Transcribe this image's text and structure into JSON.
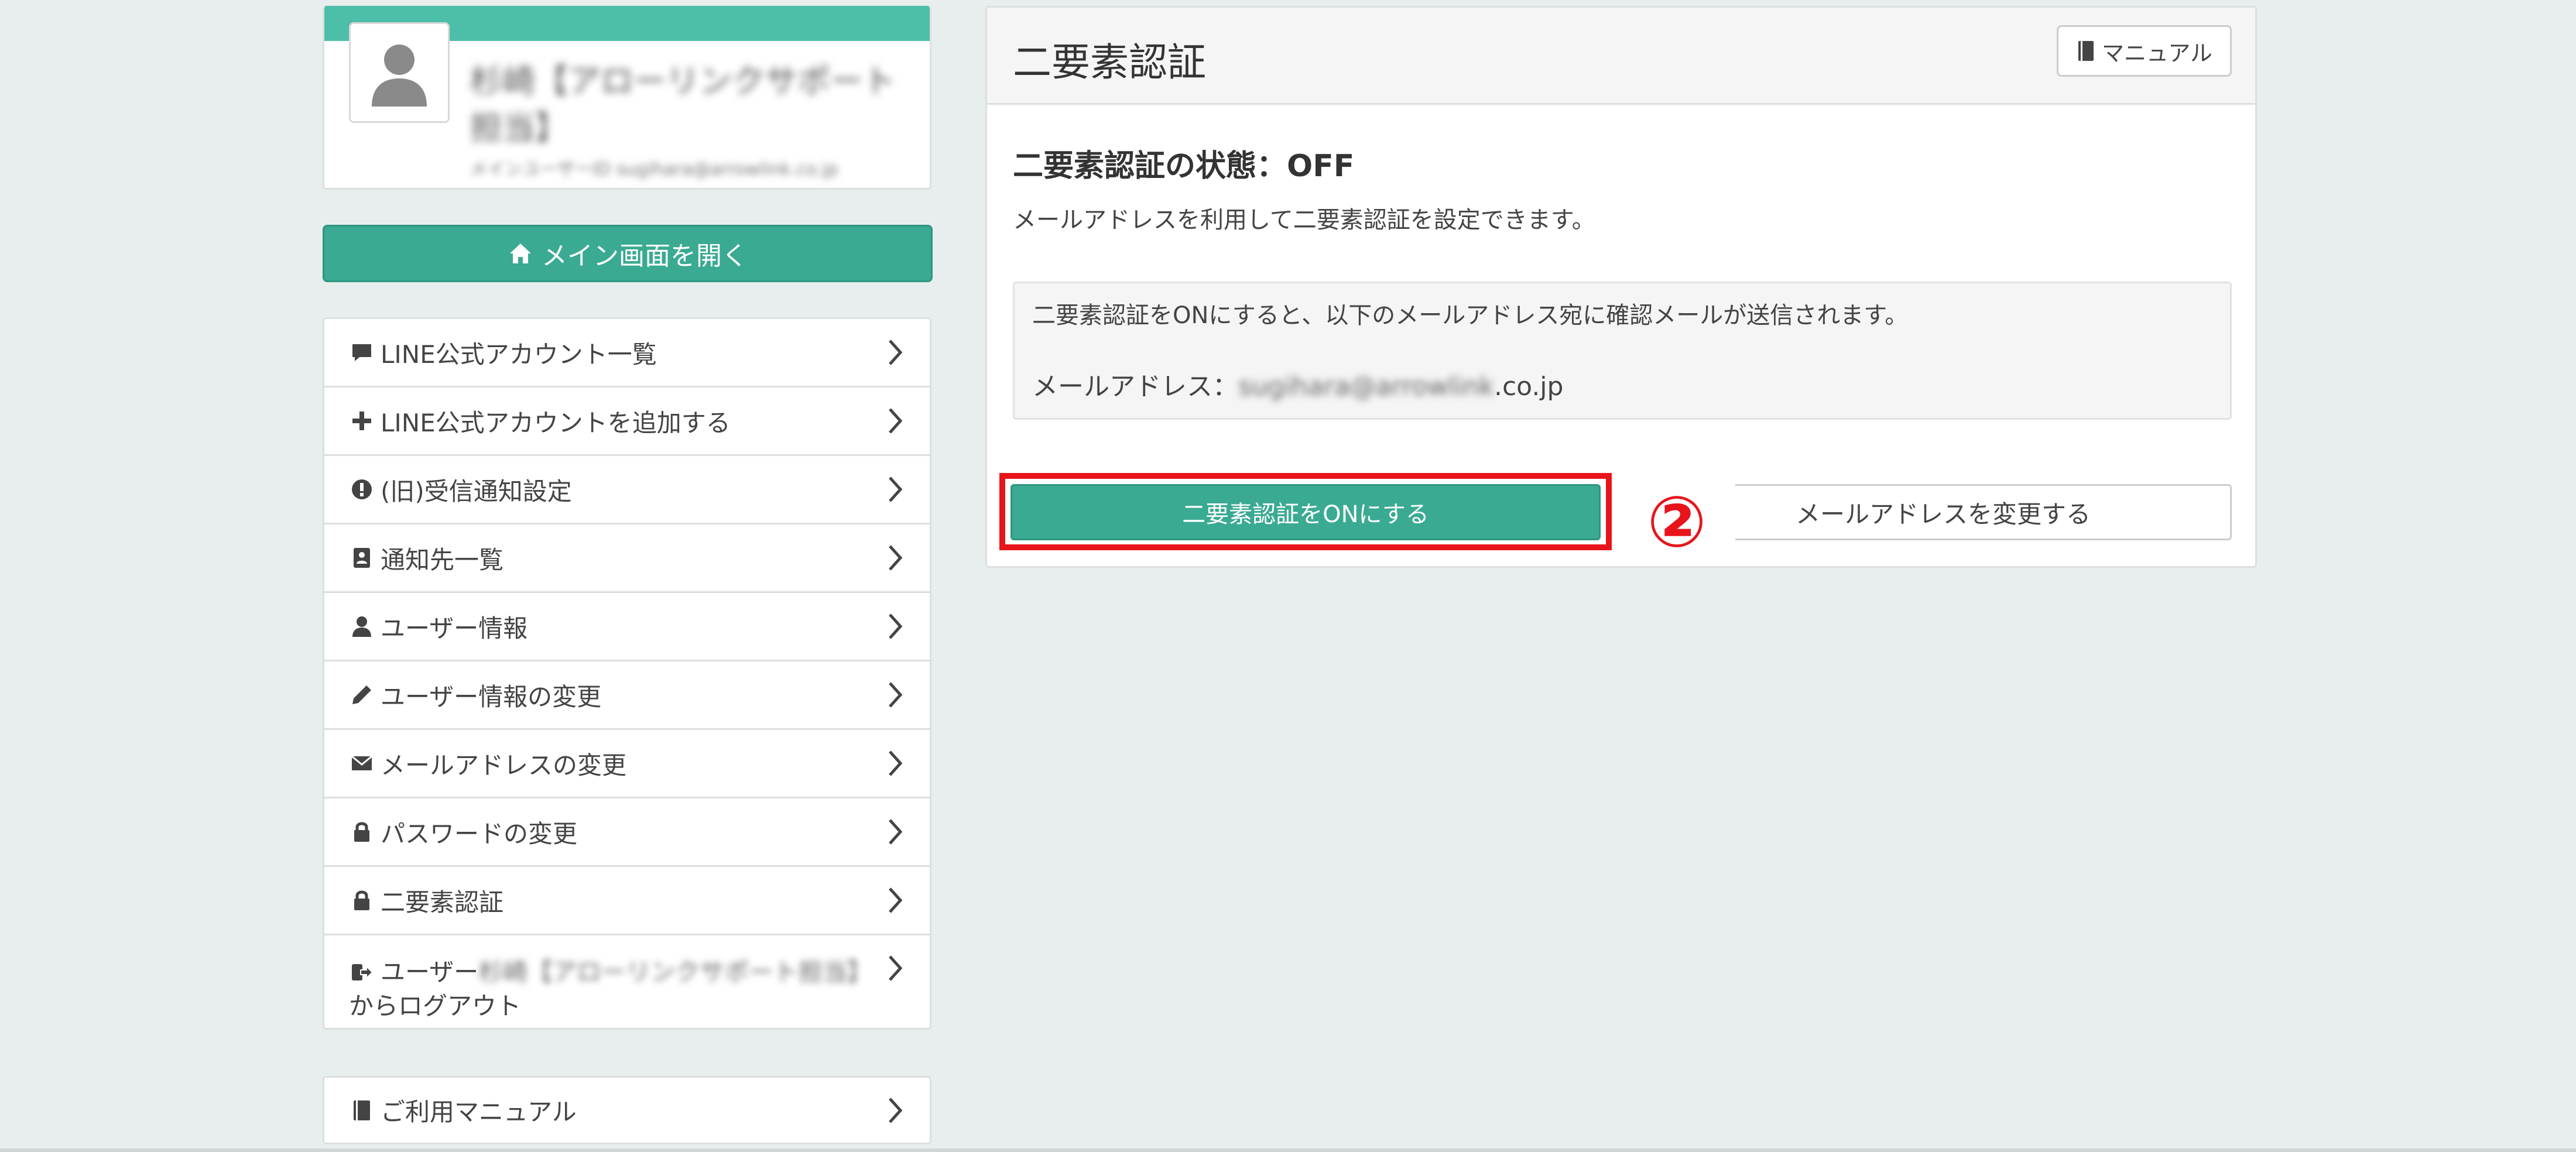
{
  "profile": {
    "name": "杉崎【アローリンクサポート担当】",
    "sub": "メインユーザーID sugihara@arrowlink.co.jp",
    "avatar_icon": "user-silhouette-icon"
  },
  "sidebar": {
    "main_button_label": "メイン画面を開く",
    "main_button_icon": "home-icon",
    "items": [
      {
        "label": "LINE公式アカウント一覧",
        "icon": "comment-icon"
      },
      {
        "label": "LINE公式アカウントを追加する",
        "icon": "plus-icon"
      },
      {
        "label": "(旧)受信通知設定",
        "icon": "exclamation-circle-icon"
      },
      {
        "label": "通知先一覧",
        "icon": "contact-book-icon"
      },
      {
        "label": "ユーザー情報",
        "icon": "user-icon"
      },
      {
        "label": "ユーザー情報の変更",
        "icon": "pencil-icon"
      },
      {
        "label": "メールアドレスの変更",
        "icon": "envelope-icon"
      },
      {
        "label": "パスワードの変更",
        "icon": "lock-icon"
      },
      {
        "label": "二要素認証",
        "icon": "lock-icon"
      },
      {
        "label_prefix": "ユーザー",
        "label_blurred": "杉崎【アローリンクサポート担当】",
        "label_suffix": "からログアウト",
        "icon": "sign-out-icon"
      }
    ],
    "manual_label": "ご利用マニュアル",
    "manual_icon": "book-icon"
  },
  "main": {
    "title": "二要素認証",
    "manual_button_label": "マニュアル",
    "manual_button_icon": "book-icon",
    "status_heading": "二要素認証の状態：OFF",
    "description": "メールアドレスを利用して二要素認証を設定できます。",
    "info_text": "二要素認証をONにすると、以下のメールアドレス宛に確認メールが送信されます。",
    "email_label": "メールアドレス：",
    "email_blurred": "sugihara@arrowlink",
    "email_domain": ".co.jp",
    "enable_button_label": "二要素認証をONにする",
    "change_email_button_label": "メールアドレスを変更する",
    "step_marker": "②"
  },
  "colors": {
    "accent": "#3aaa92",
    "header_bar": "#4dbea7",
    "highlight": "#e8141b",
    "background": "#e7eeed"
  }
}
